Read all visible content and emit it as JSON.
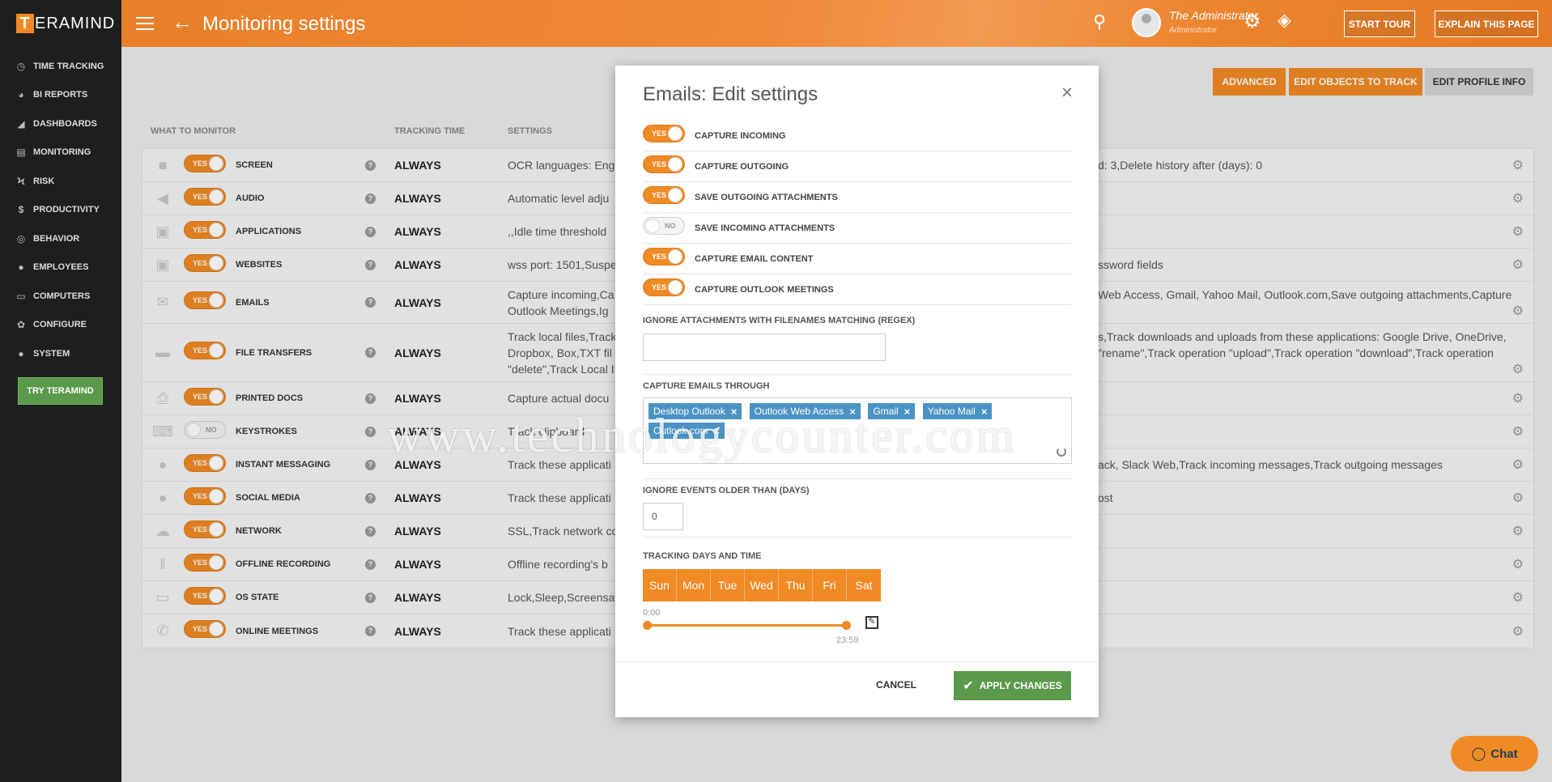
{
  "app": {
    "logo_letter": "T",
    "logo_rest": "ERAMIND",
    "title": "Monitoring settings"
  },
  "sidebar": {
    "items": [
      {
        "label": "TIME TRACKING",
        "icon": "clock-icon"
      },
      {
        "label": "BI REPORTS",
        "icon": "pie-chart-icon"
      },
      {
        "label": "DASHBOARDS",
        "icon": "area-chart-icon"
      },
      {
        "label": "MONITORING",
        "icon": "monitor-list-icon"
      },
      {
        "label": "RISK",
        "icon": "bolt-icon"
      },
      {
        "label": "PRODUCTIVITY",
        "icon": "dollar-icon"
      },
      {
        "label": "BEHAVIOR",
        "icon": "gamepad-icon"
      },
      {
        "label": "EMPLOYEES",
        "icon": "users-icon"
      },
      {
        "label": "COMPUTERS",
        "icon": "desktop-icon"
      },
      {
        "label": "CONFIGURE",
        "icon": "gear-icon"
      },
      {
        "label": "SYSTEM",
        "icon": "user-gear-icon"
      }
    ],
    "try_button": "TRY TERAMIND"
  },
  "header": {
    "user_name": "The Administrator",
    "user_role": "Administrator",
    "start_tour": "START TOUR",
    "explain": "EXPLAIN THIS PAGE"
  },
  "actions": {
    "advanced": "ADVANCED",
    "edit_objects": "EDIT OBJECTS TO TRACK",
    "edit_profile": "EDIT PROFILE INFO"
  },
  "table": {
    "columns": [
      "WHAT TO MONITOR",
      "TRACKING TIME",
      "SETTINGS"
    ],
    "rows": [
      {
        "name": "SCREEN",
        "toggle": "YES",
        "time": "ALWAYS",
        "settings": "OCR languages: Engl",
        "settings_right": "d: 3,Delete history after (days): 0"
      },
      {
        "name": "AUDIO",
        "toggle": "YES",
        "time": "ALWAYS",
        "settings": "Automatic level adju",
        "settings_right": ""
      },
      {
        "name": "APPLICATIONS",
        "toggle": "YES",
        "time": "ALWAYS",
        "settings": ",,Idle time threshold",
        "settings_right": ""
      },
      {
        "name": "WEBSITES",
        "toggle": "YES",
        "time": "ALWAYS",
        "settings": "wss port: 1501,Suspe",
        "settings_right": "ssword fields"
      },
      {
        "name": "EMAILS",
        "toggle": "YES",
        "time": "ALWAYS",
        "settings": "Capture incoming,Ca\nOutlook Meetings,Ig",
        "settings_right": "Web Access, Gmail, Yahoo Mail, Outlook.com,Save outgoing attachments,Capture"
      },
      {
        "name": "FILE TRANSFERS",
        "toggle": "YES",
        "time": "ALWAYS",
        "settings": "Track local files,Track\nDropbox, Box,TXT fil\n\"delete\",Track Local I",
        "settings_right": "s,Track downloads and uploads from these applications: Google Drive, OneDrive,\n\"rename\",Track operation \"upload\",Track operation \"download\",Track operation"
      },
      {
        "name": "PRINTED DOCS",
        "toggle": "YES",
        "time": "ALWAYS",
        "settings": "Capture actual docu",
        "settings_right": ""
      },
      {
        "name": "KEYSTROKES",
        "toggle": "NO",
        "time": "ALWAYS",
        "settings": "Track clipboard",
        "settings_right": ""
      },
      {
        "name": "INSTANT MESSAGING",
        "toggle": "YES",
        "time": "ALWAYS",
        "settings": "Track these applicati",
        "settings_right": "ack, Slack Web,Track incoming messages,Track outgoing messages"
      },
      {
        "name": "SOCIAL MEDIA",
        "toggle": "YES",
        "time": "ALWAYS",
        "settings": "Track these applicati",
        "settings_right": "ost"
      },
      {
        "name": "NETWORK",
        "toggle": "YES",
        "time": "ALWAYS",
        "settings": "SSL,Track network co",
        "settings_right": ""
      },
      {
        "name": "OFFLINE RECORDING",
        "toggle": "YES",
        "time": "ALWAYS",
        "settings": "Offline recording's b",
        "settings_right": ""
      },
      {
        "name": "OS STATE",
        "toggle": "YES",
        "time": "ALWAYS",
        "settings": "Lock,Sleep,Screensav",
        "settings_right": ""
      },
      {
        "name": "ONLINE MEETINGS",
        "toggle": "YES",
        "time": "ALWAYS",
        "settings": "Track these applicati",
        "settings_right": ""
      }
    ]
  },
  "modal": {
    "title": "Emails: Edit settings",
    "close": "×",
    "toggles": [
      {
        "label": "CAPTURE INCOMING",
        "state": "YES"
      },
      {
        "label": "CAPTURE OUTGOING",
        "state": "YES"
      },
      {
        "label": "SAVE OUTGOING ATTACHMENTS",
        "state": "YES"
      },
      {
        "label": "SAVE INCOMING ATTACHMENTS",
        "state": "NO"
      },
      {
        "label": "CAPTURE EMAIL CONTENT",
        "state": "YES"
      },
      {
        "label": "CAPTURE OUTLOOK MEETINGS",
        "state": "YES"
      }
    ],
    "ignore_attachments_label": "IGNORE ATTACHMENTS WITH FILENAMES MATCHING (REGEX)",
    "ignore_attachments_value": "",
    "capture_through_label": "CAPTURE EMAILS THROUGH",
    "capture_through": [
      "Desktop Outlook",
      "Outlook Web Access",
      "Gmail",
      "Yahoo Mail",
      "Outlook.com"
    ],
    "ignore_older_label": "IGNORE EVENTS OLDER THAN (DAYS)",
    "ignore_older_value": "0",
    "tracking_label": "TRACKING DAYS AND TIME",
    "days": [
      "Sun",
      "Mon",
      "Tue",
      "Wed",
      "Thu",
      "Fri",
      "Sat"
    ],
    "time_start": "0:00",
    "time_end": "23:59",
    "cancel": "CANCEL",
    "apply": "APPLY CHANGES"
  },
  "watermark": "www.technologycounter.com",
  "chat": "Chat",
  "colors": {
    "accent": "#f08a24",
    "sidebar": "#1e1e1e",
    "success": "#5a9a4a",
    "tag": "#4a93c4"
  }
}
